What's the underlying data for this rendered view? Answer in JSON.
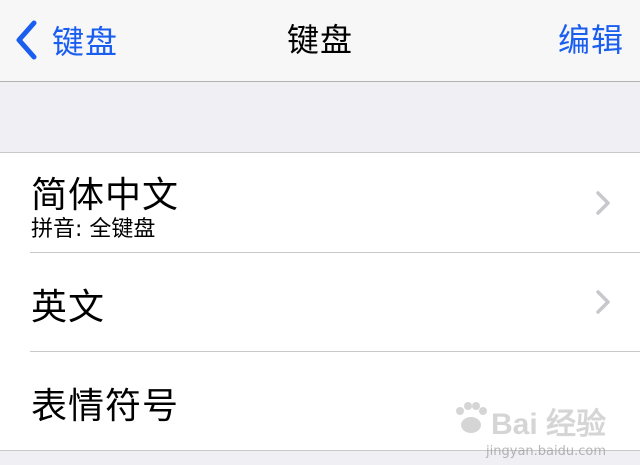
{
  "navbar": {
    "back_label": "键盘",
    "title": "键盘",
    "edit_label": "编辑"
  },
  "list": {
    "items": [
      {
        "title": "简体中文",
        "subtitle": "拼音: 全键盘",
        "has_chevron": true
      },
      {
        "title": "英文",
        "has_chevron": true
      },
      {
        "title": "表情符号",
        "has_chevron": false
      }
    ]
  },
  "watermark": {
    "text": "Bai 经验",
    "url": "jingyan.baidu.com"
  },
  "colors": {
    "accent": "#1a5ef0",
    "background": "#efeff4",
    "chevron": "#c7c7cc"
  }
}
